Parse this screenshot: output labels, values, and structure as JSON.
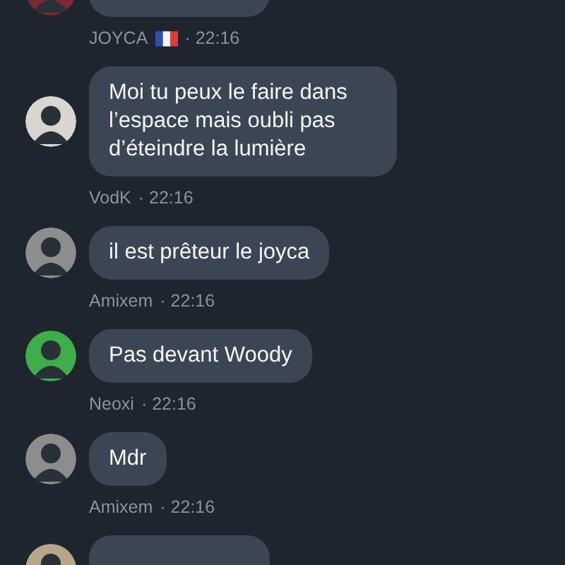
{
  "messages": [
    {
      "kind": "partial-top",
      "color": "#7a2a30",
      "sender": "JOYCA",
      "flag": true,
      "time": "· 22:16"
    },
    {
      "kind": "full",
      "color": "#d9d6cf",
      "text": "Moi tu peux le faire dans l’espace mais oubli pas d’éteindre la lumière",
      "sender": "VodK",
      "flag": false,
      "time": "· 22:16"
    },
    {
      "kind": "full",
      "color": "#8d8d8d",
      "text": "il est prêteur le joyca",
      "sender": "Amixem",
      "flag": false,
      "time": "· 22:16"
    },
    {
      "kind": "full",
      "color": "#3fae4a",
      "text": "Pas devant Woody",
      "sender": "Neoxi",
      "flag": false,
      "time": "· 22:16"
    },
    {
      "kind": "full",
      "color": "#8d8d8d",
      "text": "Mdr",
      "sender": "Amixem",
      "flag": false,
      "time": "· 22:16"
    },
    {
      "kind": "partial-bottom",
      "color": "#b9a58a"
    }
  ]
}
